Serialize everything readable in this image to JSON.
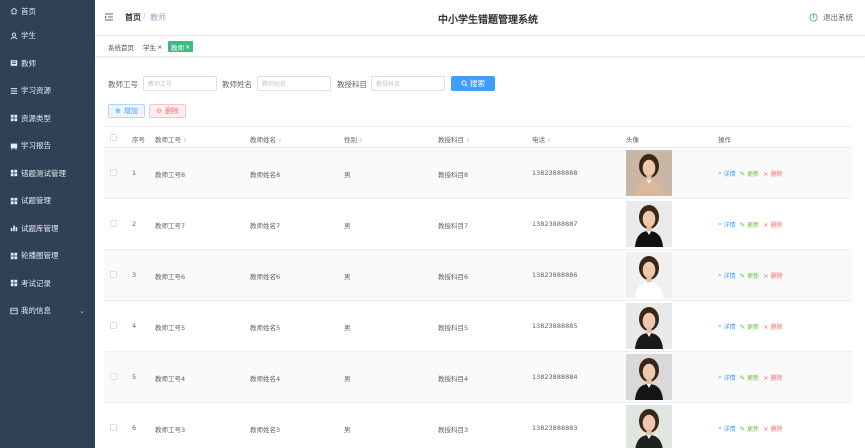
{
  "sidebar": {
    "items": [
      {
        "label": "首页",
        "icon": "home-icon"
      },
      {
        "label": "学生",
        "icon": "user-icon"
      },
      {
        "label": "教师",
        "icon": "teacher-icon"
      },
      {
        "label": "学习资源",
        "icon": "resource-icon"
      },
      {
        "label": "资源类型",
        "icon": "grid-icon"
      },
      {
        "label": "学习报告",
        "icon": "report-icon"
      },
      {
        "label": "错题测试管理",
        "icon": "grid-icon"
      },
      {
        "label": "试题管理",
        "icon": "grid-icon"
      },
      {
        "label": "试题库管理",
        "icon": "chart-icon"
      },
      {
        "label": "轮播图管理",
        "icon": "grid-icon"
      },
      {
        "label": "考试记录",
        "icon": "grid-icon"
      },
      {
        "label": "我的信息",
        "icon": "profile-icon"
      }
    ]
  },
  "header": {
    "breadcrumb_home": "首页",
    "breadcrumb_sep": "/",
    "breadcrumb_current": "教师",
    "title": "中小学生错题管理系统",
    "logout": "退出系统"
  },
  "tags": [
    {
      "label": "系统首页"
    },
    {
      "label": "学生",
      "close": "×"
    },
    {
      "label": "教师",
      "close": "×"
    }
  ],
  "search": {
    "teacher_no_label": "教师工号",
    "teacher_no_placeholder": "教师工号",
    "teacher_name_label": "教师姓名",
    "teacher_name_placeholder": "教师姓名",
    "subject_label": "教授科目",
    "subject_placeholder": "教授科目",
    "search_button": "搜索"
  },
  "actions": {
    "add": "增加",
    "delete": "删除"
  },
  "table": {
    "headers": {
      "index": "序号",
      "teacher_no": "教师工号",
      "teacher_name": "教师姓名",
      "gender": "性别",
      "subject": "教授科目",
      "phone": "电话",
      "avatar": "头像",
      "ops": "操作"
    },
    "op_labels": {
      "detail": "详情",
      "edit": "更新",
      "delete": "删除"
    },
    "rows": [
      {
        "index": "1",
        "teacher_no": "教师工号8",
        "teacher_name": "教师姓名8",
        "gender": "男",
        "subject": "教授科目8",
        "phone": "13823888888"
      },
      {
        "index": "2",
        "teacher_no": "教师工号7",
        "teacher_name": "教师姓名7",
        "gender": "男",
        "subject": "教授科目7",
        "phone": "13823888887"
      },
      {
        "index": "3",
        "teacher_no": "教师工号6",
        "teacher_name": "教师姓名6",
        "gender": "男",
        "subject": "教授科目6",
        "phone": "13823888886"
      },
      {
        "index": "4",
        "teacher_no": "教师工号5",
        "teacher_name": "教师姓名5",
        "gender": "男",
        "subject": "教授科目5",
        "phone": "13823888885"
      },
      {
        "index": "5",
        "teacher_no": "教师工号4",
        "teacher_name": "教师姓名4",
        "gender": "男",
        "subject": "教授科目4",
        "phone": "13823888884"
      },
      {
        "index": "6",
        "teacher_no": "教师工号3",
        "teacher_name": "教师姓名3",
        "gender": "男",
        "subject": "教授科目3",
        "phone": "13823888883"
      }
    ]
  },
  "colors": {
    "sidebar_bg": "#304156",
    "primary": "#409eff",
    "success": "#67c23a",
    "danger": "#f56c6c",
    "tag_active": "#42b983"
  }
}
